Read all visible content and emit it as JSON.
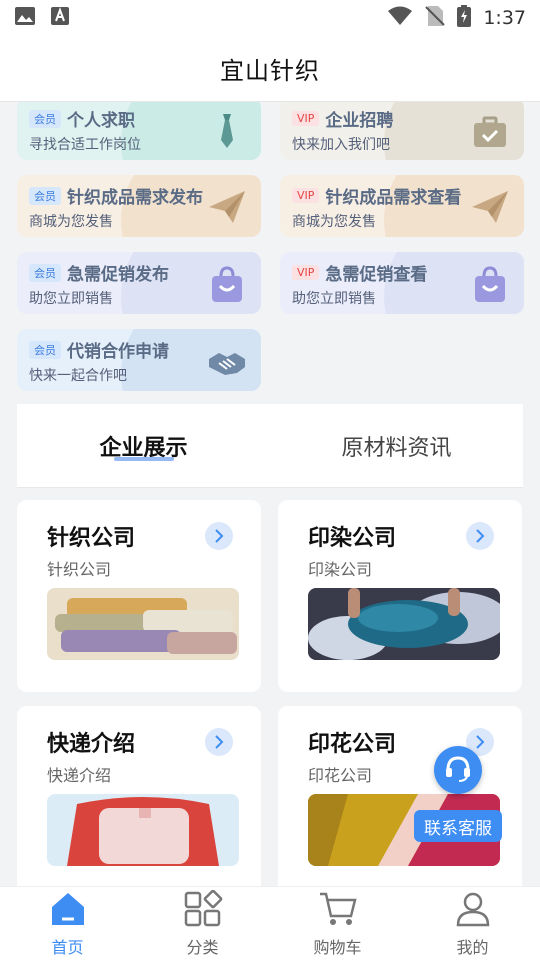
{
  "status": {
    "time": "1:37"
  },
  "header": {
    "title": "宜山针织"
  },
  "services": [
    {
      "tag": "会员",
      "tag_type": "member",
      "title": "个人求职",
      "subtitle": "寻找合适工作岗位",
      "icon": "tie-icon",
      "bg": "#e1f3f1",
      "wave": "#cbebe7"
    },
    {
      "tag": "VIP",
      "tag_type": "vip",
      "title": "企业招聘",
      "subtitle": "快来加入我们吧",
      "icon": "briefcase-icon",
      "bg": "#f2f0ea",
      "wave": "#e5e1d6"
    },
    {
      "tag": "会员",
      "tag_type": "member",
      "title": "针织成品需求发布",
      "subtitle": "商城为您发售",
      "icon": "paper-plane-icon",
      "bg": "#f8efe4",
      "wave": "#f2e1cd"
    },
    {
      "tag": "VIP",
      "tag_type": "vip",
      "title": "针织成品需求查看",
      "subtitle": "商城为您发售",
      "icon": "paper-plane-icon",
      "bg": "#f8efe4",
      "wave": "#f2e1cd"
    },
    {
      "tag": "会员",
      "tag_type": "member",
      "title": "急需促销发布",
      "subtitle": "助您立即销售",
      "icon": "shopping-bag-icon",
      "bg": "#ebeefa",
      "wave": "#dde2f5"
    },
    {
      "tag": "VIP",
      "tag_type": "vip",
      "title": "急需促销查看",
      "subtitle": "助您立即销售",
      "icon": "shopping-bag-icon",
      "bg": "#ebeefa",
      "wave": "#dde2f5"
    },
    {
      "tag": "会员",
      "tag_type": "member",
      "title": "代销合作申请",
      "subtitle": "快来一起合作吧",
      "icon": "handshake-icon",
      "bg": "#e6f0fa",
      "wave": "#d4e3f4"
    }
  ],
  "tabs": [
    {
      "label": "企业展示",
      "active": true
    },
    {
      "label": "原材料资讯",
      "active": false
    }
  ],
  "companies": [
    {
      "title": "针织公司",
      "subtitle": "针织公司",
      "image": "folded-sweaters-image"
    },
    {
      "title": "印染公司",
      "subtitle": "印染公司",
      "image": "fabric-dyeing-image"
    },
    {
      "title": "快递介绍",
      "subtitle": "快递介绍",
      "image": "delivery-box-image"
    },
    {
      "title": "印花公司",
      "subtitle": "印花公司",
      "image": "printed-fabric-image"
    }
  ],
  "support": {
    "label": "联系客服"
  },
  "nav": [
    {
      "label": "首页",
      "icon": "home-icon",
      "active": true
    },
    {
      "label": "分类",
      "icon": "category-icon",
      "active": false
    },
    {
      "label": "购物车",
      "icon": "cart-icon",
      "active": false
    },
    {
      "label": "我的",
      "icon": "user-icon",
      "active": false
    }
  ],
  "colors": {
    "accent": "#3e8df3",
    "member_tag": "#3b7de0",
    "vip_tag": "#e64545"
  }
}
